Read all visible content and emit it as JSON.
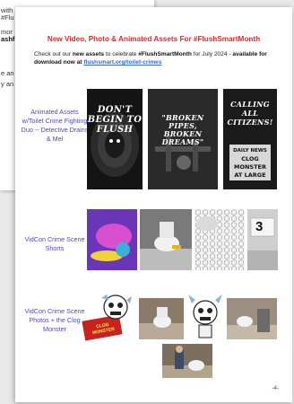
{
  "back_page": {
    "lines": [
      "with",
      "#Flu",
      "mor",
      "ashf",
      "e an",
      "y an"
    ]
  },
  "title": "New Video, Photo & Animated Assets For #FlushSmartMonth",
  "intro": {
    "part1": "Check out our ",
    "new_assets": "new assets",
    "part2": " to celebrate ",
    "hashtag": "#FlushSmartMonth",
    "part3": " for July 2024 - ",
    "available": "available for download now at ",
    "link": "flushsmart.org/toilet-crimes"
  },
  "rows": [
    {
      "label": "Animated Assets w/Toilet Crime Fighting Duo -- Detective Drains & Mel"
    },
    {
      "label": "VidCon Crime Scene Shorts"
    },
    {
      "label": "VidCon Crime Scene Photos + the Clog Monster"
    }
  ],
  "posters": [
    {
      "title": "DON'T BEGIN TO FLUSH"
    },
    {
      "title": "\"BROKEN PIPES, BROKEN DREAMS\""
    },
    {
      "title": "CALLING ALL CITIZENS!",
      "news1": "DAILY NEWS",
      "news2": "CLOG MONSTER",
      "news3": "AT LARGE"
    }
  ],
  "thumb_texts": {
    "evidence_number": "3",
    "sign_text": "CLOG MONSTER"
  },
  "icons": [
    "toilet-icon"
  ],
  "page_number": "-4-",
  "colors": {
    "title": "#e0292b",
    "label": "#4f4bb2",
    "link": "#3d6bb8"
  }
}
